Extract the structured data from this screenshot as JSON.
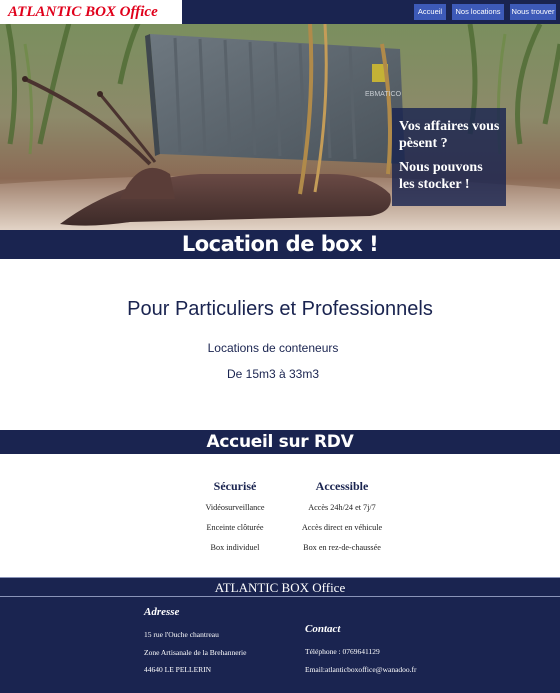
{
  "header": {
    "logo": "ATLANTIC BOX Office",
    "nav": [
      "Accueil",
      "Nos locations",
      "Nous trouver"
    ]
  },
  "hero": {
    "line1": "Vos affaires vous pèsent ?",
    "line2": "Nous pouvons les stocker !",
    "container_label": "EBMATICO"
  },
  "section1": {
    "banner": "Location de box !",
    "title": "Pour Particuliers et Professionnels",
    "line1": "Locations de conteneurs",
    "line2": "De 15m3 à 33m3"
  },
  "section2": {
    "banner": "Accueil sur RDV",
    "features": [
      {
        "title": "Sécurisé",
        "items": [
          "Vidéosurveillance",
          "Enceinte clôturée",
          "Box individuel"
        ]
      },
      {
        "title": "Accessible",
        "items": [
          "Accès 24h/24 et 7j/7",
          "Accès direct en véhicule",
          "Box en rez-de-chaussée"
        ]
      }
    ]
  },
  "footer": {
    "title": "ATLANTIC BOX Office",
    "address": {
      "heading": "Adresse",
      "lines": [
        "15 rue l'Ouche chantreau",
        "Zone Artisanale de la Brehannerie",
        "44640 LE PELLERIN"
      ]
    },
    "contact": {
      "heading": "Contact",
      "lines": [
        "Téléphone : 0769641129",
        "Email:atlanticboxoffice@wanadoo.fr"
      ]
    }
  }
}
